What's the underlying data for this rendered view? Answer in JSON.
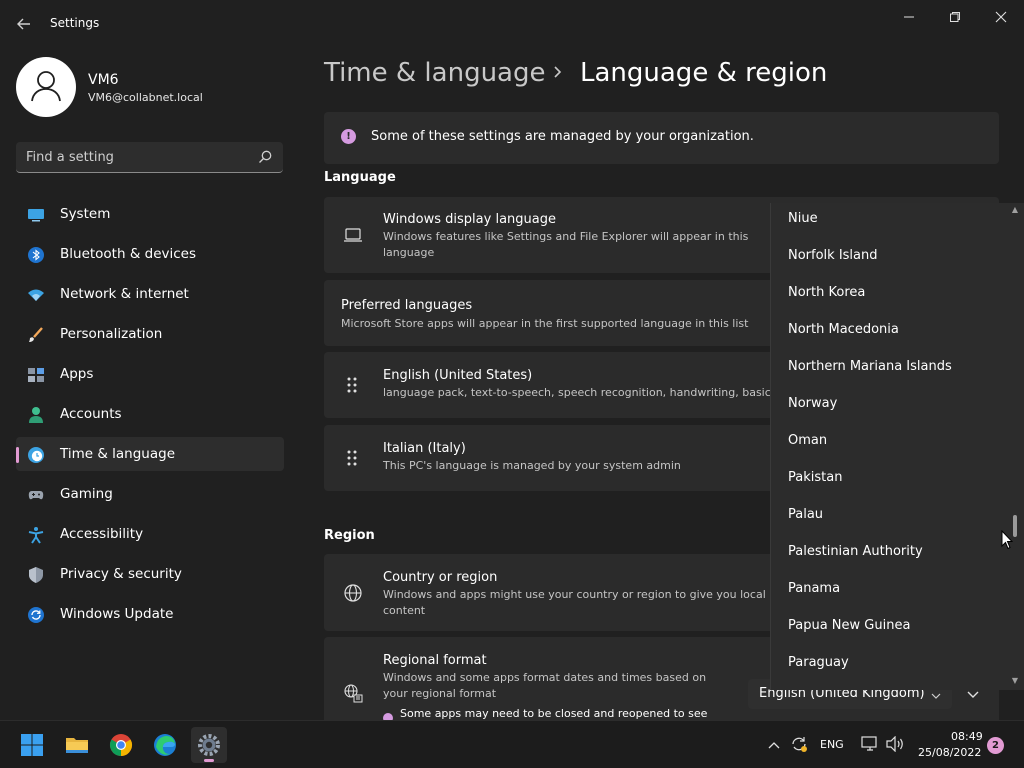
{
  "window": {
    "title": "Settings",
    "back_icon": "back-arrow-icon",
    "controls": [
      "minimize-icon",
      "maximize-icon",
      "close-icon"
    ]
  },
  "profile": {
    "name": "VM6",
    "email": "VM6@collabnet.local"
  },
  "search": {
    "placeholder": "Find a setting"
  },
  "nav": {
    "items": [
      {
        "label": "System",
        "icon": "system-icon"
      },
      {
        "label": "Bluetooth & devices",
        "icon": "bluetooth-icon"
      },
      {
        "label": "Network & internet",
        "icon": "network-icon"
      },
      {
        "label": "Personalization",
        "icon": "brush-icon"
      },
      {
        "label": "Apps",
        "icon": "apps-icon"
      },
      {
        "label": "Accounts",
        "icon": "accounts-icon"
      },
      {
        "label": "Time & language",
        "icon": "time-language-icon",
        "active": true
      },
      {
        "label": "Gaming",
        "icon": "gaming-icon"
      },
      {
        "label": "Accessibility",
        "icon": "accessibility-icon"
      },
      {
        "label": "Privacy & security",
        "icon": "shield-icon"
      },
      {
        "label": "Windows Update",
        "icon": "update-icon"
      }
    ]
  },
  "header": {
    "breadcrumb_parent": "Time & language",
    "separator": "›",
    "title": "Language & region"
  },
  "info": {
    "text": "Some of these settings are managed by your organization."
  },
  "language": {
    "section_title": "Language",
    "display_language": {
      "title": "Windows display language",
      "subtitle": "Windows features like Settings and File Explorer will appear in this language"
    },
    "preferred": {
      "title": "Preferred languages",
      "subtitle": "Microsoft Store apps will appear in the first supported language in this list"
    },
    "languages": [
      {
        "title": "English (United States)",
        "subtitle": "language pack, text-to-speech, speech recognition, handwriting, basic t"
      },
      {
        "title": "Italian (Italy)",
        "subtitle": "This PC's language is managed by your system admin"
      }
    ]
  },
  "region": {
    "section_title": "Region",
    "country": {
      "title": "Country or region",
      "subtitle": "Windows and apps might use your country or region to give you local content"
    },
    "format": {
      "title": "Regional format",
      "subtitle": "Windows and some apps format dates and times based on your regional format",
      "note": "Some apps may need to be closed and reopened to see",
      "value": "English (United Kingdom)"
    }
  },
  "country_dropdown": {
    "options": [
      "Niue",
      "Norfolk Island",
      "North Korea",
      "North Macedonia",
      "Northern Mariana Islands",
      "Norway",
      "Oman",
      "Pakistan",
      "Palau",
      "Palestinian Authority",
      "Panama",
      "Papua New Guinea",
      "Paraguay"
    ]
  },
  "taskbar": {
    "apps": [
      "windows-start-icon",
      "file-explorer-icon",
      "chrome-icon",
      "edge-icon",
      "settings-icon"
    ],
    "language": "ENG",
    "time": "08:49",
    "date": "25/08/2022",
    "notifications": "2"
  }
}
